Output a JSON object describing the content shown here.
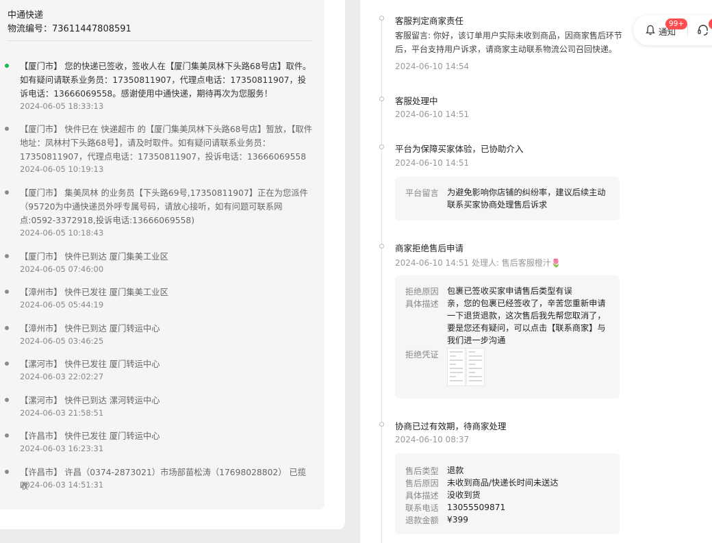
{
  "logistics": {
    "courier": "中通快递",
    "tracking_label": "物流编号：73611447808591",
    "events": [
      {
        "text": "【厦门市】 您的快递已签收，签收人在【厦门集美凤林下头路68号店】取件。如有疑问请联系业务员：17350811907，代理点电话：17350811907，投诉电话：13666069558。感谢使用中通快递，期待再次为您服务！",
        "time": "2024-06-05 18:33:13"
      },
      {
        "text": "【厦门市】 快件已在 快递超市 的【厦门集美凤林下头路68号店】暂放，【取件地址：凤林村下头路68号】，请及时取件。如有疑问请联系业务员：17350811907，代理点电话：17350811907，投诉电话：13666069558",
        "time": "2024-06-05 10:19:13"
      },
      {
        "text": "【厦门市】 集美凤林 的业务员【下头路69号,17350811907】正在为您派件（95720为中通快递员外呼专属号码，请放心接听，如有问题可联系网点:0592-3372918,投诉电话:13666069558)",
        "time": "2024-06-05 10:18:43"
      },
      {
        "text": "【厦门市】 快件已到达 厦门集美工业区",
        "time": "2024-06-05 07:46:00"
      },
      {
        "text": "【漳州市】 快件已发往 厦门集美工业区",
        "time": "2024-06-05 05:44:19"
      },
      {
        "text": "【漳州市】 快件已到达 厦门转运中心",
        "time": "2024-06-05 03:46:25"
      },
      {
        "text": "【漯河市】 快件已发往 厦门转运中心",
        "time": "2024-06-03 22:02:27"
      },
      {
        "text": "【漯河市】 快件已到达 漯河转运中心",
        "time": "2024-06-03 21:58:51"
      },
      {
        "text": "【许昌市】 快件已发往 厦门转运中心",
        "time": "2024-06-03 16:23:31"
      },
      {
        "text": "【许昌市】 许昌（0374-2873021）市场部苗松涛（17698028802） 已揽收",
        "time": "2024-06-03 14:51:31"
      }
    ]
  },
  "header": {
    "notify_label": "通知",
    "notify_badge": "99+"
  },
  "aftersale": {
    "step1": {
      "title": "客服判定商家责任",
      "message_line1": "客服留言: 你好，该订单用户实际未收到商品，因商家售后环节",
      "message_line2": "后，平台支持用户诉求，请商家主动联系物流公司召回快递。",
      "time": "2024-06-10 14:54"
    },
    "step2": {
      "title": "客服处理中",
      "time": "2024-06-10 14:51"
    },
    "step3": {
      "title": "平台为保障买家体验，已协助介入",
      "time": "2024-06-10 14:51",
      "box_key": "平台留言",
      "box_val": "为避免影响你店铺的纠纷率，建议后续主动联系买家协商处理售后诉求"
    },
    "step4": {
      "title": "商家拒绝售后申请",
      "time": "2024-06-10 14:51 处理人: 售后客服橙汁🌷",
      "reason_key": "拒绝原因",
      "reason_val": "包裹已签收买家申请售后类型有误",
      "desc_key": "具体描述",
      "desc_val": "亲，您的包裹已经签收了，辛苦您重新申请一下退货退款，这次售后我先帮您取消了，要是您还有疑问，可以点击【联系商家】与我们进一步沟通",
      "proof_key": "拒绝凭证"
    },
    "step5": {
      "title": "协商已过有效期，待商家处理",
      "time": "2024-06-10 08:37",
      "rows": [
        {
          "key": "售后类型",
          "val": "退款"
        },
        {
          "key": "售后原因",
          "val": "未收到商品/快递长时间未送达"
        },
        {
          "key": "具体描述",
          "val": "没收到货"
        },
        {
          "key": "联系电话",
          "val": "13055509871"
        },
        {
          "key": "退款金额",
          "val": "¥399"
        }
      ]
    }
  }
}
